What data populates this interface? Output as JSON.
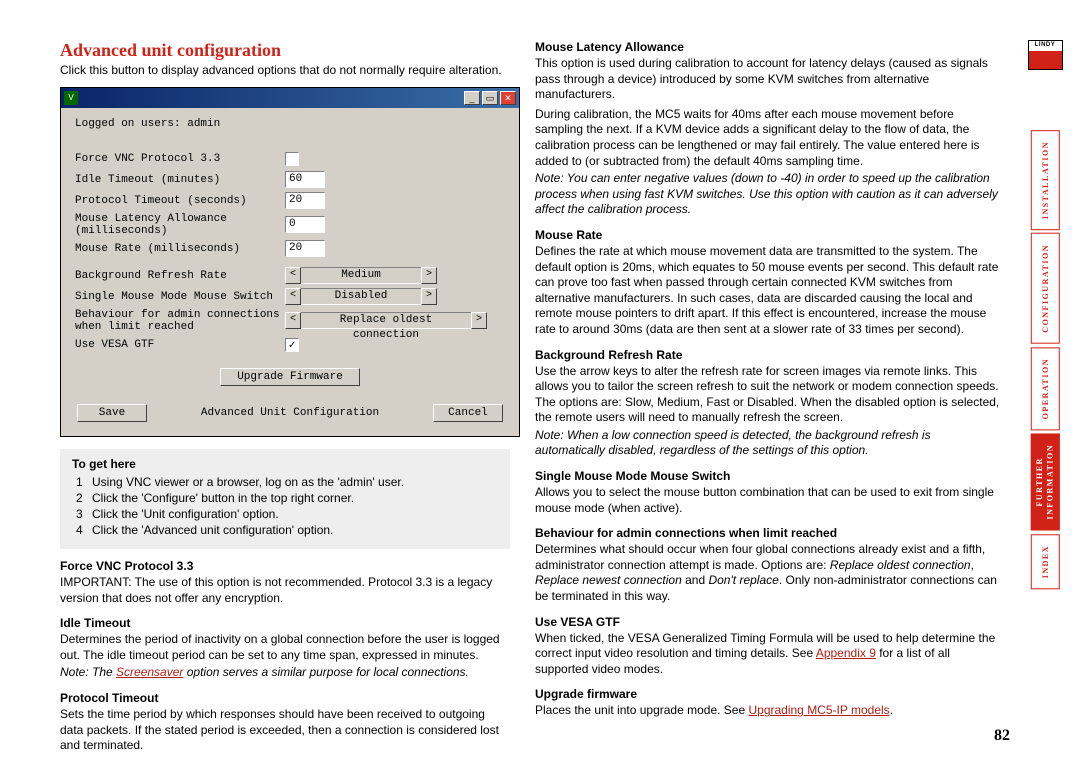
{
  "page_number": "82",
  "logo_text": "LINDY",
  "sidebar_tabs": {
    "installation": "INSTALLATION",
    "configuration": "CONFIGURATION",
    "operation": "OPERATION",
    "further_info": "FURTHER\nINFORMATION",
    "index": "INDEX"
  },
  "title": "Advanced unit configuration",
  "intro": "Click this button to display advanced options that do not normally require alteration.",
  "vnc": {
    "logged_on": "Logged on users: admin",
    "labels": {
      "force_vnc": "Force VNC Protocol 3.3",
      "idle_timeout": "Idle Timeout (minutes)",
      "protocol_timeout": "Protocol Timeout (seconds)",
      "mouse_latency": "Mouse Latency Allowance\n(milliseconds)",
      "mouse_rate": "Mouse Rate (milliseconds)",
      "bg_refresh": "Background Refresh Rate",
      "single_mouse": "Single Mouse Mode Mouse Switch",
      "behaviour": "Behaviour for admin connections\nwhen limit reached",
      "use_vesa": "Use VESA GTF"
    },
    "values": {
      "force_vnc_checked": false,
      "idle_timeout": "60",
      "protocol_timeout": "20",
      "mouse_latency": "0",
      "mouse_rate": "20",
      "bg_refresh": "Medium",
      "single_mouse": "Disabled",
      "behaviour": "Replace oldest connection",
      "use_vesa_checked": true
    },
    "buttons": {
      "upgrade": "Upgrade Firmware",
      "save": "Save",
      "title_label": "Advanced Unit Configuration",
      "cancel": "Cancel"
    }
  },
  "to_get_here": {
    "heading": "To get here",
    "steps": [
      "Using VNC viewer or a browser, log on as the 'admin' user.",
      "Click the 'Configure' button in the top right corner.",
      "Click the 'Unit configuration' option.",
      "Click the 'Advanced unit configuration' option."
    ]
  },
  "sections_left": {
    "force_vnc_h": "Force VNC Protocol 3.3",
    "force_vnc_p": "IMPORTANT: The use of this option is not recommended. Protocol 3.3 is a legacy version that does not offer any encryption.",
    "idle_h": "Idle Timeout",
    "idle_p": "Determines the period of inactivity on a global connection before the user is logged out. The idle timeout period can be set to any time span, expressed in minutes.",
    "idle_note_prefix": "Note: The ",
    "idle_note_link": "Screensaver",
    "idle_note_suffix": " option serves a similar purpose for local connections.",
    "protocol_h": "Protocol Timeout",
    "protocol_p": "Sets the time period by which responses should have been received to outgoing data packets. If the stated period is exceeded, then a connection is considered lost and terminated."
  },
  "sections_right": {
    "latency_h": "Mouse Latency Allowance",
    "latency_p1": "This option is used during calibration to account for latency delays (caused as signals pass through a device) introduced by some KVM switches from alternative manufacturers.",
    "latency_p2": "During calibration, the MC5 waits for 40ms after each mouse movement before sampling the next. If a KVM device adds a significant delay to the flow of data, the calibration process can be lengthened or may fail entirely. The value entered here is added to (or subtracted from) the default 40ms sampling time.",
    "latency_note": "Note: You can enter negative values (down to -40) in order to speed up the calibration process when using fast KVM switches. Use this option with caution as it can adversely affect the calibration process.",
    "rate_h": "Mouse Rate",
    "rate_p": "Defines the rate at which mouse movement data are transmitted to the system. The default option is 20ms, which equates to 50 mouse events per second. This default rate can prove too fast when passed through certain connected KVM switches from alternative manufacturers. In such cases, data are discarded causing the local and remote mouse pointers to drift apart. If this effect is encountered, increase the mouse rate to around 30ms (data are then sent at a slower rate of 33 times per second).",
    "bg_h": "Background Refresh Rate",
    "bg_p": "Use the arrow keys to alter the refresh rate for screen images via remote links. This allows you to tailor the screen refresh to suit the network or modem connection speeds. The options are: Slow, Medium, Fast or Disabled. When the disabled option is selected, the remote users will need to manually refresh the screen.",
    "bg_note": "Note: When a low connection speed is detected, the background refresh is automatically disabled, regardless of the settings of this option.",
    "single_h": "Single Mouse Mode Mouse Switch",
    "single_p": "Allows you to select the mouse button combination that can be used to exit from single mouse mode (when active).",
    "behaviour_h": "Behaviour for admin connections when limit reached",
    "behaviour_p1": "Determines what should occur when four global connections already exist and a fifth, administrator connection attempt is made. Options are: ",
    "behaviour_i1": "Replace oldest connection",
    "behaviour_s1": ", ",
    "behaviour_i2": "Replace newest connection",
    "behaviour_s2": " and ",
    "behaviour_i3": "Don't replace",
    "behaviour_s3": ". Only non-administrator connections can be terminated in this way.",
    "vesa_h": "Use VESA GTF",
    "vesa_p1": "When ticked, the VESA Generalized Timing Formula will be used to help determine the correct input video resolution and timing details. See ",
    "vesa_link": "Appendix 9",
    "vesa_p2": " for a list of all supported video modes.",
    "upgrade_h": "Upgrade firmware",
    "upgrade_p1": "Places the unit into upgrade mode. See ",
    "upgrade_link": "Upgrading MC5-IP models",
    "upgrade_p2": "."
  }
}
